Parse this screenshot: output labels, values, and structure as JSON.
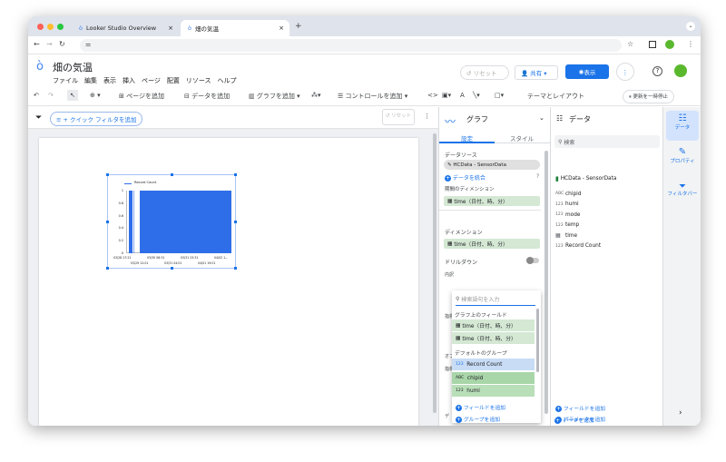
{
  "browser": {
    "tabs": [
      {
        "title": "Looker Studio Overview",
        "close": "×"
      },
      {
        "title": "畑の気温",
        "close": "×"
      }
    ],
    "new_tab": "+"
  },
  "colors": {
    "accent": "#1a73e8",
    "chart_fill": "#2f6ee9",
    "chip_green": "#d4e8d4"
  },
  "app": {
    "title": "畑の気温",
    "menu": [
      "ファイル",
      "編集",
      "表示",
      "挿入",
      "ページ",
      "配置",
      "リソース",
      "ヘルプ"
    ],
    "reset": "リセット",
    "share": "共有",
    "view": "表示"
  },
  "toolbar": {
    "add_page": "ページを追加",
    "add_data": "データを追加",
    "add_chart": "グラフを追加",
    "add_control": "コントロールを追加",
    "theme": "テーマとレイアウト",
    "pause": "更新を一時停止"
  },
  "filterbar": {
    "quick_filter": "+ クイック フィルタを追加",
    "reset": "リセット"
  },
  "chart": {
    "legend": "Record Count",
    "y_ticks": [
      "1",
      "0.8",
      "0.6",
      "0.4",
      "0.2",
      "0"
    ],
    "x_row1": [
      "03/28 17:21",
      "03/30 06:31",
      "03/31 23:31",
      "04/02 1..."
    ],
    "x_row2": [
      "03/29 12:01",
      "03/31 04:01",
      "04/01 19:01"
    ]
  },
  "chart_data": {
    "type": "bar",
    "title": "",
    "series": [
      {
        "name": "Record Count"
      }
    ],
    "categories": [
      "03/28 17:21",
      "03/29 12:01",
      "03/30 06:31",
      "03/31 04:01",
      "03/31 23:31",
      "04/01 19:01",
      "04/02 1..."
    ],
    "ylim": [
      0,
      1
    ]
  },
  "props": {
    "header": "グラフ",
    "tab_setup": "設定",
    "tab_style": "スタイル",
    "datasource_label": "データソース",
    "datasource": "HCData - SensorData",
    "merge": "データを統合",
    "date_dim_label": "期間のディメンション",
    "date_dim": "time（日付、時、分）",
    "dim_label": "ディメンション",
    "dim": "time（日付、時、分）",
    "drilldown": "ドリルダウン",
    "inner_label": "内訳",
    "metric_label": "指標",
    "opt_label": "オプ",
    "dr_label": "指標",
    "de_label": "デ"
  },
  "dropdown": {
    "placeholder": "検索語句を入力",
    "sec1": "グラフ上のフィールド",
    "f1": "time（日付、時、分）",
    "f2": "time（日付、時、分）",
    "sec2": "デフォルトのグループ",
    "f3": "Record Count",
    "f4": "chipid",
    "f5": "humi",
    "add_field": "フィールドを追加",
    "add_group": "グループを追加",
    "t1": "123",
    "t2": "ABC",
    "t3": "123"
  },
  "data": {
    "header": "データ",
    "search": "検索",
    "source": "HCData - SensorData",
    "fields": [
      {
        "type": "ABC",
        "name": "chipid"
      },
      {
        "type": "123",
        "name": "humi"
      },
      {
        "type": "123",
        "name": "mode"
      },
      {
        "type": "123",
        "name": "temp"
      },
      {
        "type": "cal",
        "name": "time"
      },
      {
        "type": "123",
        "name": "Record Count"
      }
    ],
    "add_field": "フィールドを追加",
    "add_param": "パラメータを追加",
    "add_data": "データを追加"
  },
  "rail": {
    "data": "データ",
    "props": "プロパティ",
    "filter": "フィルタバー"
  }
}
